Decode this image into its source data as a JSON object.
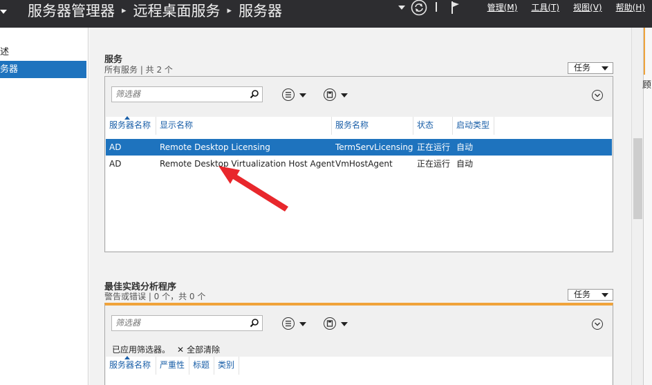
{
  "header": {
    "breadcrumb": [
      "服务器管理器",
      "远程桌面服务",
      "服务器"
    ],
    "menu": [
      "管理(M)",
      "工具(T)",
      "视图(V)",
      "帮助(H)"
    ],
    "colors": {
      "bar": "#2d2d30",
      "selected": "#1e73be",
      "accent": "#f0a33a"
    }
  },
  "sidebar": {
    "items": [
      {
        "label": "述",
        "selected": false
      },
      {
        "label": "务器",
        "selected": true
      }
    ]
  },
  "services": {
    "title": "服务",
    "subtitle": "所有服务 | 共 2 个",
    "tasks_label": "任务",
    "filter_placeholder": "筛选器",
    "columns": [
      "服务器名称",
      "显示名称",
      "服务名称",
      "状态",
      "启动类型"
    ],
    "rows": [
      {
        "server": "AD",
        "display": "Remote Desktop Licensing",
        "service": "TermServLicensing",
        "status": "正在运行",
        "startup": "自动",
        "selected": true
      },
      {
        "server": "AD",
        "display": "Remote Desktop Virtualization Host Agent",
        "service": "VmHostAgent",
        "status": "正在运行",
        "startup": "自动",
        "selected": false
      }
    ]
  },
  "bpa": {
    "title": "最佳实践分析程序",
    "subtitle": "警告或错误 | 0 个，共 0 个",
    "tasks_label": "任务",
    "filter_placeholder": "筛选器",
    "filter_applied": "已应用筛选器。",
    "clear_all": "全部清除",
    "columns": [
      "服务器名称",
      "严重性",
      "标题",
      "类别"
    ]
  },
  "right_pane": {
    "text": "顾"
  }
}
